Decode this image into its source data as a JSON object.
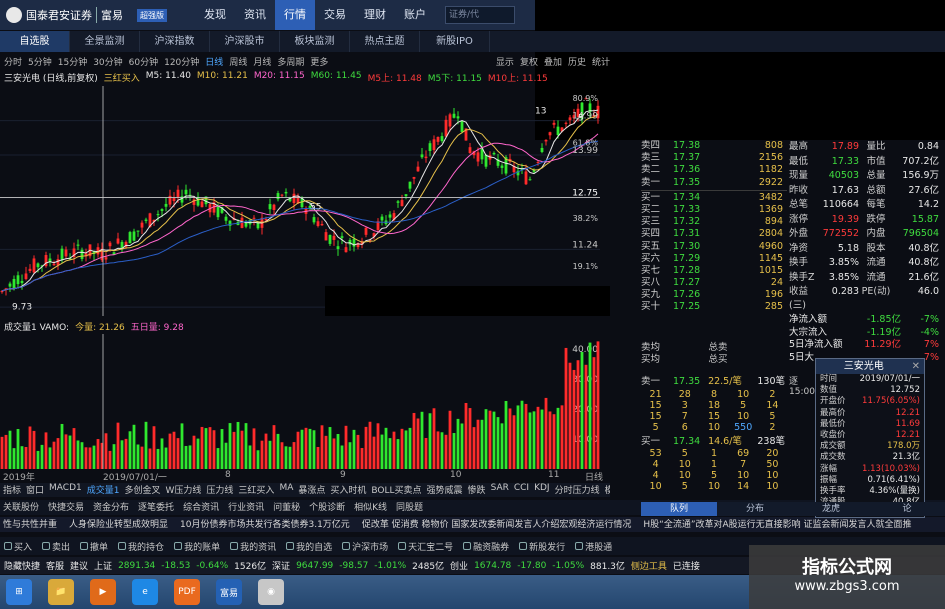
{
  "topbar": {
    "brand": "国泰君安证券",
    "brand_sub": "富易",
    "version": "超强版",
    "nav": [
      "发现",
      "资讯",
      "行情",
      "交易",
      "理财",
      "账户"
    ],
    "nav_active": 2,
    "search_placeholder": "证券/代"
  },
  "tabs": {
    "items": [
      "自选股",
      "全景监测",
      "沪深指数",
      "沪深股市",
      "板块监测",
      "热点主题",
      "新股IPO"
    ],
    "active": 0
  },
  "periods": {
    "items": [
      "分时",
      "5分钟",
      "15分钟",
      "30分钟",
      "60分钟",
      "120分钟",
      "日线",
      "周线",
      "月线",
      "多周期",
      "更多"
    ],
    "active": 6,
    "right": [
      "显示",
      "复权",
      "叠加",
      "历史",
      "统计"
    ]
  },
  "indicator_line": {
    "stock": "三安光电 (日线,前复权)",
    "signal": "三红买入",
    "ma": [
      {
        "label": "M5: 11.40",
        "color": "#e8e8e8"
      },
      {
        "label": "M10: 11.21",
        "color": "#e6c04a"
      },
      {
        "label": "M20: 11.15",
        "color": "#ff66cc"
      },
      {
        "label": "M60: 11.45",
        "color": "#3fdc3f"
      },
      {
        "label": "M5上: 11.48",
        "color": "#ff3b3b"
      },
      {
        "label": "M5下: 11.15",
        "color": "#3fdc3f"
      },
      {
        "label": "M10上: 11.15",
        "color": "#ff3b3b"
      }
    ]
  },
  "chart_data": {
    "type": "candlestick",
    "price_axis": [
      "14.99",
      "13.99",
      "12.75",
      "11.24",
      "9.56"
    ],
    "pct_axis": [
      "80.9%",
      "61.8%",
      "38.2%",
      "19.1%"
    ],
    "price_range": [
      9.3,
      16.0
    ],
    "crosshair_price": 12.75,
    "annotations": [
      "9.73",
      "55",
      "13",
      "5"
    ],
    "volume": {
      "label": "成交量1 VAMO:",
      "today": "今量: 21.26",
      "five_day": "五日量: 9.28",
      "axis": [
        "40.00",
        "30.00",
        "20.00",
        "10.00"
      ],
      "range": [
        0,
        45
      ]
    },
    "dates": [
      "2019年",
      "2019/07/01/一",
      "8",
      "9",
      "10",
      "11",
      "日线"
    ]
  },
  "indicator_tabs": [
    "指标",
    "窗口",
    "MACD1",
    "成交量1",
    "多创金叉",
    "W压力线",
    "压力线",
    "三红买入",
    "MA",
    "暴涨点",
    "买入时机",
    "BOLL买卖点",
    "强势威震",
    "惨跌",
    "SAR",
    "CCI",
    "KDJ",
    "分时压力线",
    "模板"
  ],
  "toolrow": [
    "关联股份",
    "快捷交易",
    "资金分布",
    "逐笔委托",
    "综合资讯",
    "行业资讯",
    "问董秘",
    "个股诊断",
    "相似K线",
    "同股题"
  ],
  "news": [
    "性与共性并重",
    "人身保险业转型成效明显",
    "10月份债券市场共发行各类债券3.1万亿元",
    "促改革 促消费 稳物价 国家发改委新闻发言人介绍宏观经济运行情况",
    "H股“全流通”改革对A股运行无直接影响 证监会新闻发言人就全面推"
  ],
  "actions": [
    "买入",
    "卖出",
    "撤单",
    "我的持仓",
    "我的账单",
    "我的资讯",
    "我的自选",
    "沪深市场",
    "天汇宝二号",
    "融资融券",
    "新股发行",
    "港股通"
  ],
  "statusrow": [
    {
      "t": "隐藏快捷",
      "c": "#e8e8e8"
    },
    {
      "t": "客服",
      "c": "#e8e8e8"
    },
    {
      "t": "建议",
      "c": "#e8e8e8"
    },
    {
      "t": "上证",
      "c": "#e8e8e8"
    },
    {
      "t": "2891.34",
      "c": "#3fdc3f"
    },
    {
      "t": "-18.53",
      "c": "#3fdc3f"
    },
    {
      "t": "-0.64%",
      "c": "#3fdc3f"
    },
    {
      "t": "1526亿",
      "c": "#e8e8e8"
    },
    {
      "t": "深证",
      "c": "#e8e8e8"
    },
    {
      "t": "9647.99",
      "c": "#3fdc3f"
    },
    {
      "t": "-98.57",
      "c": "#3fdc3f"
    },
    {
      "t": "-1.01%",
      "c": "#3fdc3f"
    },
    {
      "t": "2485亿",
      "c": "#e8e8e8"
    },
    {
      "t": "创业",
      "c": "#e8e8e8"
    },
    {
      "t": "1674.78",
      "c": "#3fdc3f"
    },
    {
      "t": "-17.80",
      "c": "#3fdc3f"
    },
    {
      "t": "-1.05%",
      "c": "#3fdc3f"
    },
    {
      "t": "881.3亿",
      "c": "#e8e8e8"
    },
    {
      "t": "侧边工具",
      "c": "#e6c04a"
    },
    {
      "t": "已连接",
      "c": "#e8e8e8"
    }
  ],
  "orderbook": {
    "asks": [
      {
        "l": "卖四",
        "p": "17.38",
        "v": "808"
      },
      {
        "l": "卖三",
        "p": "17.37",
        "v": "2156"
      },
      {
        "l": "卖二",
        "p": "17.36",
        "v": "1182"
      },
      {
        "l": "卖一",
        "p": "17.35",
        "v": "2922"
      }
    ],
    "bids": [
      {
        "l": "买一",
        "p": "17.34",
        "v": "3482"
      },
      {
        "l": "买二",
        "p": "17.33",
        "v": "1369"
      },
      {
        "l": "买三",
        "p": "17.32",
        "v": "894"
      },
      {
        "l": "买四",
        "p": "17.31",
        "v": "2804"
      },
      {
        "l": "买五",
        "p": "17.30",
        "v": "4960"
      },
      {
        "l": "买六",
        "p": "17.29",
        "v": "1145"
      },
      {
        "l": "买七",
        "p": "17.28",
        "v": "1015"
      },
      {
        "l": "买八",
        "p": "17.27",
        "v": "24"
      },
      {
        "l": "买九",
        "p": "17.26",
        "v": "196"
      },
      {
        "l": "买十",
        "p": "17.25",
        "v": "285"
      }
    ],
    "avg_sell": "卖均",
    "avg_buy": "买均",
    "total_sell": "总卖",
    "total_buy": "总买"
  },
  "quote": [
    {
      "k": "最高",
      "v": "17.89",
      "vc": "#ff3b3b",
      "k2": "量比",
      "v2": "0.84",
      "v2c": "#e8e8e8"
    },
    {
      "k": "最低",
      "v": "17.33",
      "vc": "#3fdc3f",
      "k2": "市值",
      "v2": "707.2亿",
      "v2c": "#e8e8e8"
    },
    {
      "k": "现量",
      "v": "40503",
      "vc": "#3fdc3f",
      "k2": "总量",
      "v2": "156.9万",
      "v2c": "#e8e8e8"
    },
    {
      "k": "昨收",
      "v": "17.63",
      "vc": "#e8e8e8",
      "k2": "总额",
      "v2": "27.6亿",
      "v2c": "#e8e8e8"
    },
    {
      "k": "总笔",
      "v": "110664",
      "vc": "#e8e8e8",
      "k2": "每笔",
      "v2": "14.2",
      "v2c": "#e8e8e8"
    },
    {
      "k": "涨停",
      "v": "19.39",
      "vc": "#ff3b3b",
      "k2": "跌停",
      "v2": "15.87",
      "v2c": "#3fdc3f"
    },
    {
      "k": "外盘",
      "v": "772552",
      "vc": "#ff3b3b",
      "k2": "内盘",
      "v2": "796504",
      "v2c": "#3fdc3f"
    },
    {
      "k": "净资",
      "v": "5.18",
      "vc": "#e8e8e8",
      "k2": "股本",
      "v2": "40.8亿",
      "v2c": "#e8e8e8"
    },
    {
      "k": "换手",
      "v": "3.85%",
      "vc": "#e8e8e8",
      "k2": "流通",
      "v2": "40.8亿",
      "v2c": "#e8e8e8"
    },
    {
      "k": "换手Z",
      "v": "3.85%",
      "vc": "#e8e8e8",
      "k2": "流通",
      "v2": "21.6亿",
      "v2c": "#e8e8e8"
    },
    {
      "k": "收益(三)",
      "v": "0.283",
      "vc": "#e8e8e8",
      "k2": "PE(动)",
      "v2": "46.0",
      "v2c": "#e8e8e8"
    }
  ],
  "netflow": [
    {
      "k": "净流入额",
      "v": "-1.85亿",
      "p": "-7%"
    },
    {
      "k": "大宗流入",
      "v": "-1.19亿",
      "p": "-4%"
    },
    {
      "k": "5日净流入额",
      "v": "11.29亿",
      "p": "7%"
    },
    {
      "k": "5日大",
      "v": "",
      "p": "7%"
    }
  ],
  "trade": {
    "sell1": "卖一",
    "sell1_price": "17.35",
    "sell1_mid": "22.5/笔",
    "sell1_cnt": "130笔",
    "sell_grid": [
      "21",
      "28",
      "8",
      "10",
      "2",
      "15",
      "3",
      "18",
      "5",
      "14",
      "15",
      "7",
      "15",
      "10",
      "5",
      "5",
      "6",
      "10",
      "550",
      "2"
    ],
    "buy1": "买一",
    "buy1_price": "17.34",
    "buy1_mid": "14.6/笔",
    "buy1_cnt": "238笔",
    "buy_grid": [
      "53",
      "5",
      "1",
      "69",
      "20",
      "4",
      "10",
      "1",
      "7",
      "50",
      "4",
      "10",
      "5",
      "10",
      "10",
      "10",
      "5",
      "10",
      "14",
      "10"
    ]
  },
  "tick_small": {
    "label": "逐",
    "time": "15:00"
  },
  "popup": {
    "title": "三安光电",
    "rows": [
      {
        "k": "时间",
        "v": "2019/07/01/一",
        "vc": "#e8e8e8"
      },
      {
        "k": "数值",
        "v": "12.752",
        "vc": "#e8e8e8"
      },
      {
        "k": "开盘价",
        "v": "11.75(6.05%)",
        "vc": "#ff3b3b"
      },
      {
        "k": "最高价",
        "v": "12.21",
        "vc": "#ff3b3b"
      },
      {
        "k": "最低价",
        "v": "11.69",
        "vc": "#ff3b3b"
      },
      {
        "k": "收盘价",
        "v": "12.21",
        "vc": "#ff3b3b"
      },
      {
        "k": "成交额",
        "v": "178.0万",
        "vc": "#e6c04a"
      },
      {
        "k": "成交数",
        "v": "21.3亿",
        "vc": "#e8e8e8"
      },
      {
        "k": "涨幅",
        "v": "1.13(10.03%)",
        "vc": "#ff3b3b"
      },
      {
        "k": "振幅",
        "v": "0.71(6.41%)",
        "vc": "#e8e8e8"
      },
      {
        "k": "换手率",
        "v": "4.36%(量换)",
        "vc": "#e8e8e8"
      },
      {
        "k": "流通股",
        "v": "40.8亿",
        "vc": "#e8e8e8"
      }
    ]
  },
  "bottomtabs": {
    "items": [
      "队列",
      "分布",
      "龙虎",
      "论"
    ],
    "active": 0
  },
  "watermark": {
    "line1": "指标公式网",
    "line2": "www.zbgs3.com"
  },
  "taskbar": [
    {
      "name": "start",
      "label": "⊞",
      "color": "#2f7bd9"
    },
    {
      "name": "explorer",
      "label": "📁",
      "color": "#d9a93a"
    },
    {
      "name": "media",
      "label": "▶",
      "color": "#e06a1a"
    },
    {
      "name": "browser",
      "label": "e",
      "color": "#1e88e5"
    },
    {
      "name": "pdf",
      "label": "PDF",
      "color": "#e96a1f"
    },
    {
      "name": "fuyi",
      "label": "富易",
      "color": "#2461b4"
    },
    {
      "name": "chrome",
      "label": "◉",
      "color": "#c7c7c7"
    }
  ]
}
